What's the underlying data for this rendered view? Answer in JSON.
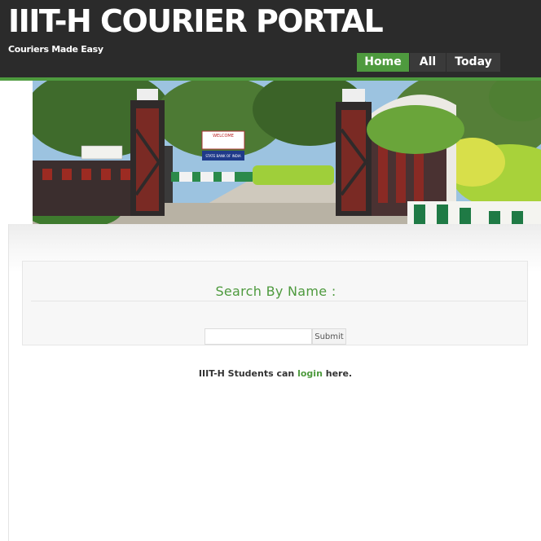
{
  "header": {
    "title": "IIIT-H COURIER PORTAL",
    "tagline": "Couriers Made Easy",
    "nav": [
      {
        "label": "Home",
        "active": true
      },
      {
        "label": "All",
        "active": false
      },
      {
        "label": "Today",
        "active": false
      }
    ]
  },
  "banner": {
    "welcome_sign": "WELCOME",
    "bank_sign": "STATE BANK OF INDIA"
  },
  "search": {
    "heading": "Search By Name :",
    "input_value": "",
    "submit_label": "Submit"
  },
  "login_note": {
    "prefix": "IIIT-H Students can ",
    "link": "login",
    "suffix": " here."
  },
  "colors": {
    "accent": "#4e9a3e",
    "header_bg": "#2b2b2b"
  }
}
